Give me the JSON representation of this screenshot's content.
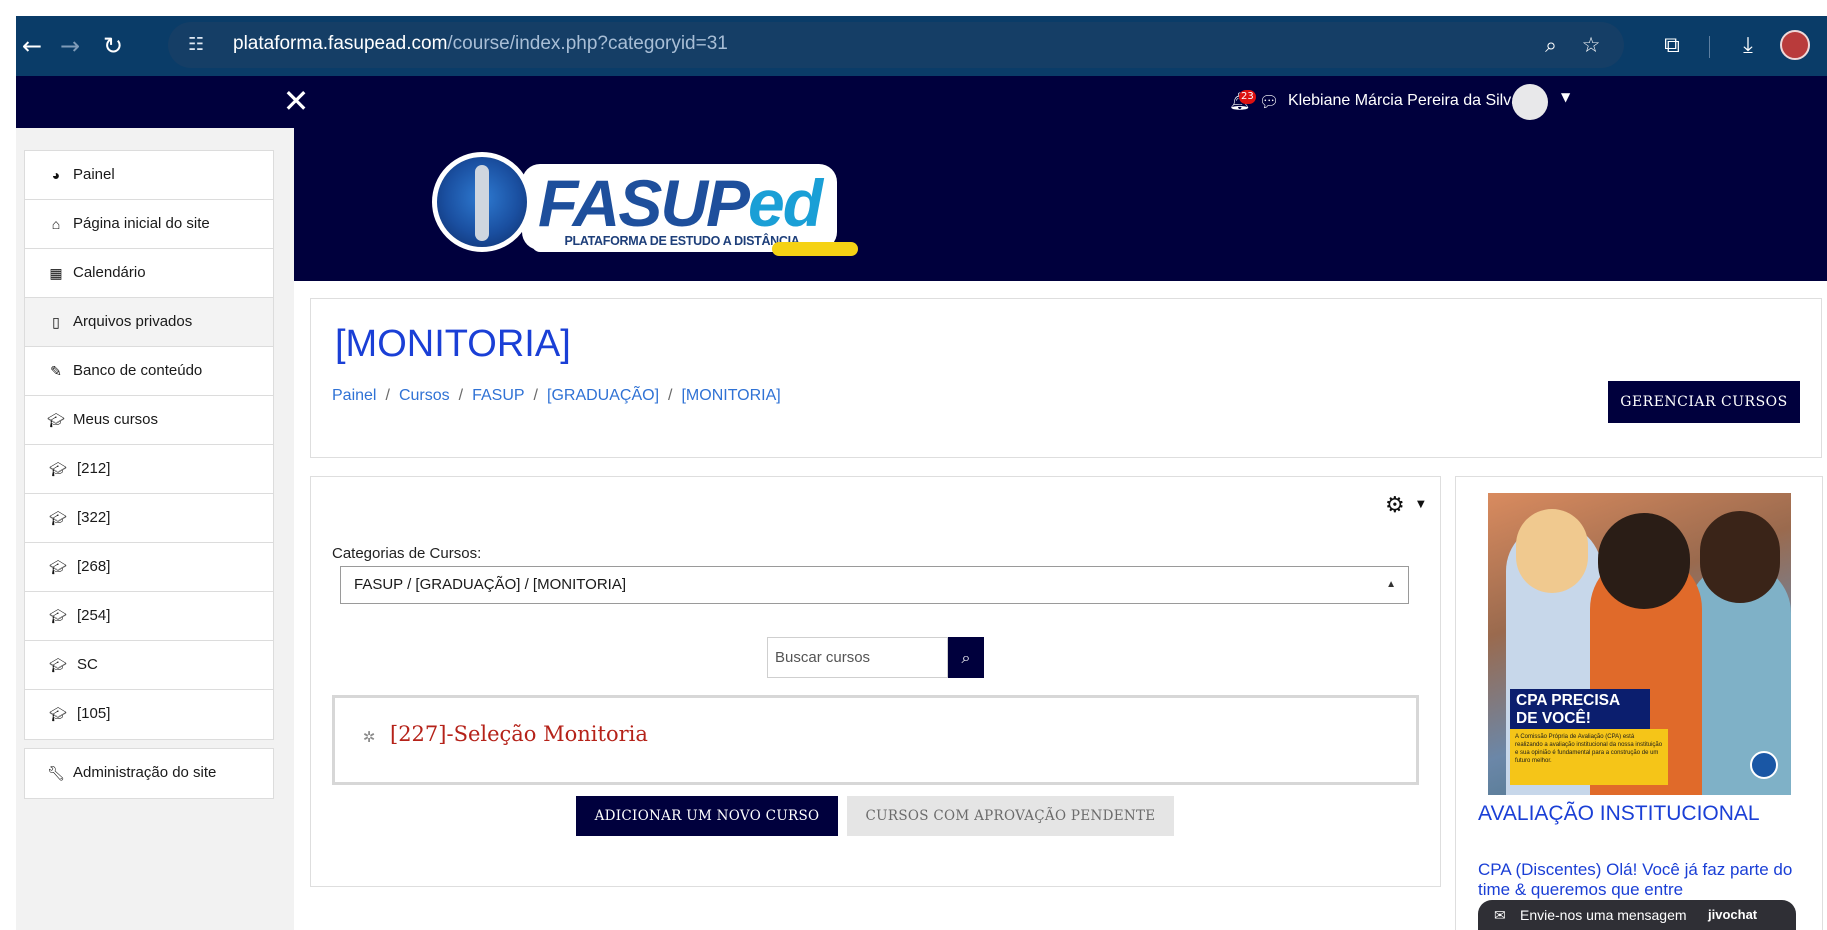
{
  "browser": {
    "url_host": "plataforma.fasupead.com",
    "url_path": "/course/index.php?categoryid=31"
  },
  "topbar": {
    "notification_count": "23",
    "user_name": "Klebiane Márcia Pereira da Silva"
  },
  "logo": {
    "word_main": "FASUP",
    "word_accent": "ed",
    "tagline": "PLATAFORMA DE ESTUDO A DISTÂNCIA"
  },
  "sidebar": {
    "items": [
      {
        "label": "Painel",
        "icon": "dashboard-icon"
      },
      {
        "label": "Página inicial do site",
        "icon": "home-icon"
      },
      {
        "label": "Calendário",
        "icon": "calendar-icon"
      },
      {
        "label": "Arquivos privados",
        "icon": "file-icon"
      },
      {
        "label": "Banco de conteúdo",
        "icon": "brush-icon"
      },
      {
        "label": "Meus cursos",
        "icon": "graduation-cap-icon"
      }
    ],
    "courses": [
      "[212]",
      "[322]",
      "[268]",
      "[254]",
      "SC",
      "[105]"
    ],
    "admin_label": "Administração do site"
  },
  "header": {
    "title": "[MONITORIA]",
    "breadcrumbs": [
      "Painel",
      "Cursos",
      "FASUP",
      "[GRADUAÇÃO]",
      "[MONITORIA]"
    ],
    "manage_button": "GERENCIAR CURSOS"
  },
  "main": {
    "category_label": "Categorias de Cursos:",
    "category_selected": "FASUP / [GRADUAÇÃO] / [MONITORIA]",
    "search_placeholder": "Buscar cursos",
    "course_name": "[227]-Seleção Monitoria",
    "add_course_button": "ADICIONAR UM NOVO CURSO",
    "pending_button": "CURSOS COM APROVAÇÃO PENDENTE"
  },
  "side_block": {
    "image_title_line1": "CPA PRECISA",
    "image_title_line2": "DE VOCÊ!",
    "image_text": "A Comissão Própria de Avaliação (CPA) está realizando a avaliação institucional da nossa instituição e sua opinião é fundamental para a construção de um futuro melhor.",
    "heading": "AVALIAÇÃO INSTITUCIONAL",
    "description": "CPA (Discentes) Olá! Você já faz parte do time & queremos que entre"
  },
  "chat_widget": {
    "message": "Envie-nos uma mensagem",
    "brand": "jivochat"
  },
  "colors": {
    "browser_bar": "#0a3c68",
    "site_navy": "#00003d",
    "link_blue": "#1a3fd6",
    "course_red": "#b52219"
  }
}
